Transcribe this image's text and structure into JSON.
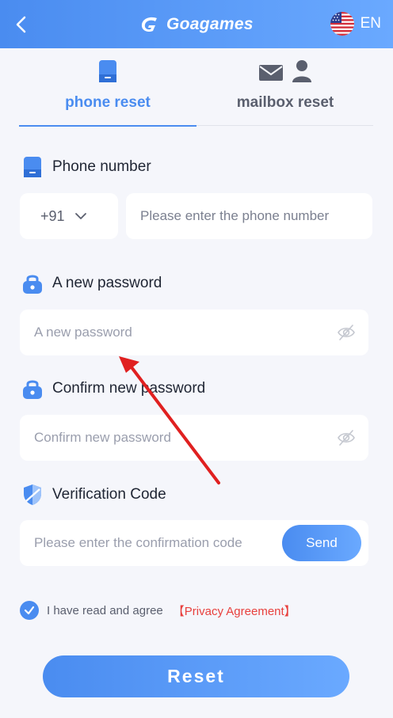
{
  "header": {
    "brand": "Goagames",
    "language": "EN"
  },
  "tabs": [
    {
      "label": "phone reset",
      "active": true
    },
    {
      "label": "mailbox reset",
      "active": false
    }
  ],
  "phone": {
    "label": "Phone number",
    "country_code": "+91",
    "placeholder": "Please enter the phone number"
  },
  "new_password": {
    "label": "A new password",
    "placeholder": "A new password"
  },
  "confirm_password": {
    "label": "Confirm new password",
    "placeholder": "Confirm new password"
  },
  "verification": {
    "label": "Verification Code",
    "placeholder": "Please enter the confirmation code",
    "send_label": "Send"
  },
  "agreement": {
    "text": "I have read and agree",
    "link": "【Privacy Agreement】",
    "checked": true
  },
  "reset_label": "Reset",
  "colors": {
    "primary": "#4a8cf0",
    "background": "#f5f6fb",
    "link_red": "#e8403d",
    "annotation_arrow": "#e02020"
  },
  "icons": [
    "back-arrow-icon",
    "logo-g-icon",
    "us-flag-icon",
    "phone-icon",
    "mail-icon",
    "user-icon",
    "lock-icon",
    "eye-off-icon",
    "shield-icon",
    "checkmark-icon",
    "chevron-down-icon"
  ]
}
